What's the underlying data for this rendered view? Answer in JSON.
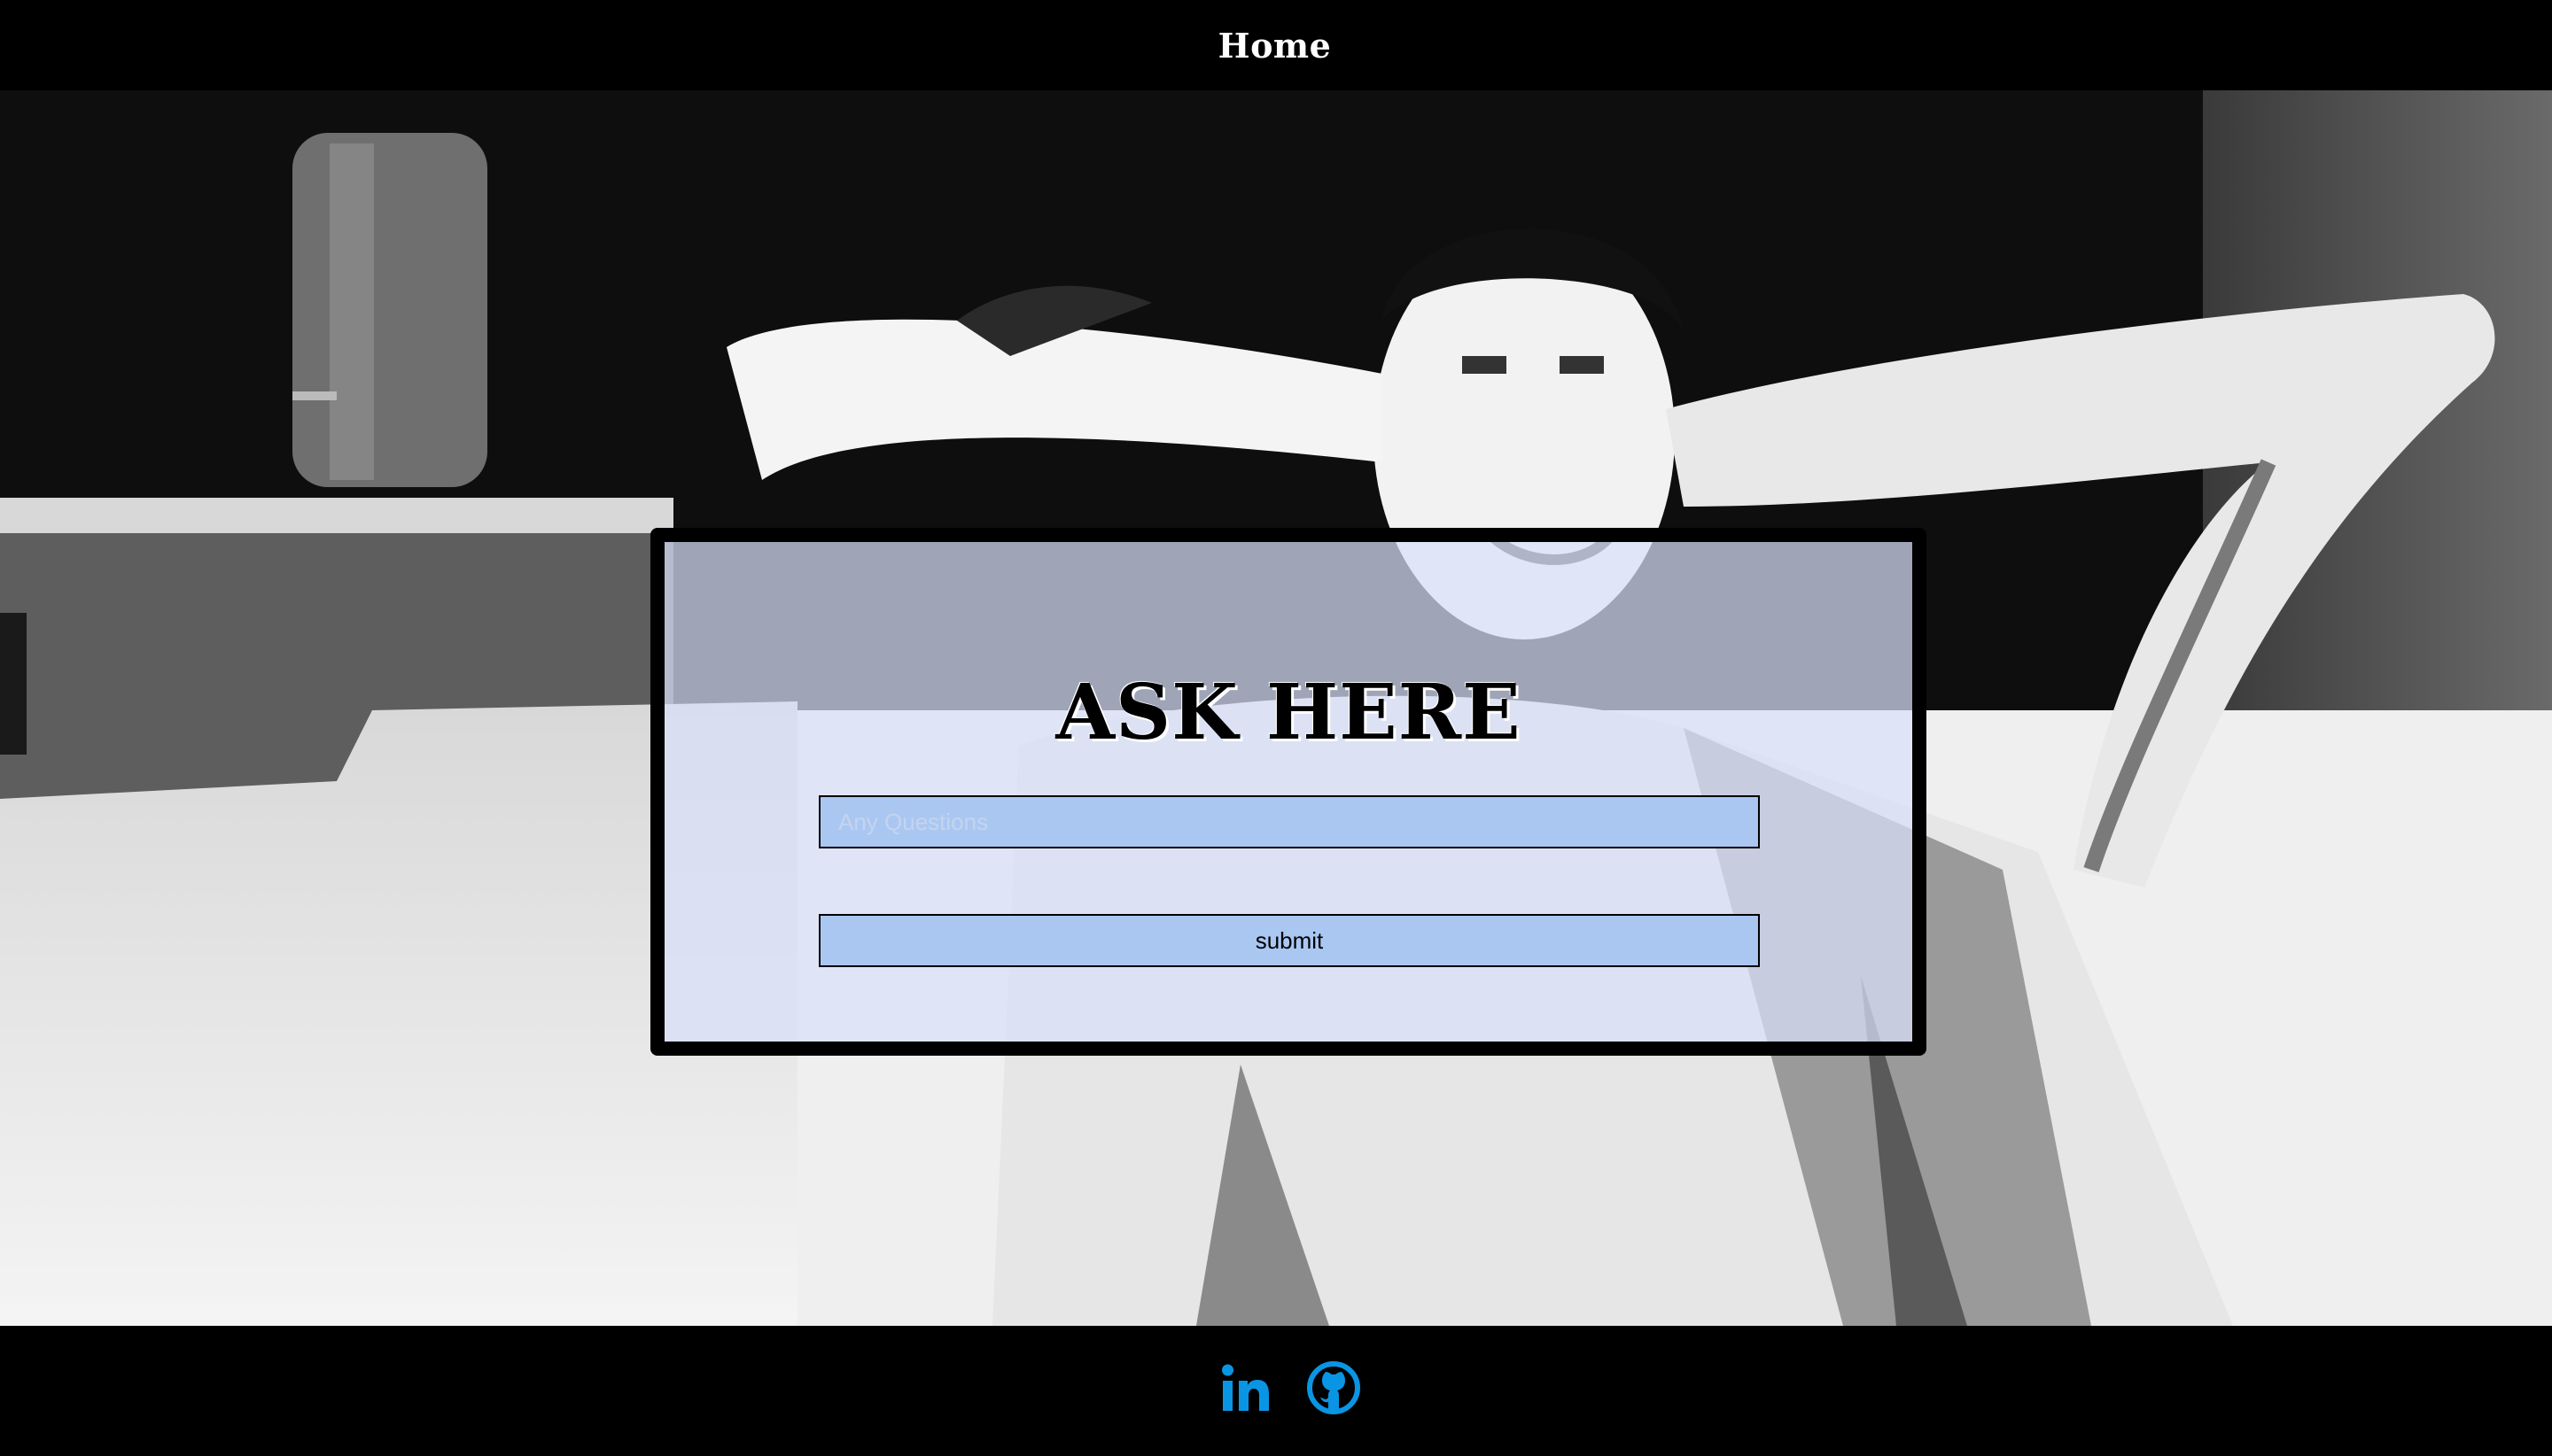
{
  "nav": {
    "home_label": "Home"
  },
  "form": {
    "title": "ASK HERE",
    "question_placeholder": "Any Questions",
    "question_value": "",
    "submit_label": "submit"
  },
  "footer": {
    "social_links": [
      {
        "icon": "linkedin-icon",
        "color": "#0a95e4"
      },
      {
        "icon": "github-icon",
        "color": "#0a95e4"
      }
    ]
  },
  "colors": {
    "background": "#000000",
    "card_fill": "#d8e0fa",
    "field_fill": "#aac7f2",
    "icon_blue": "#0a95e4"
  }
}
